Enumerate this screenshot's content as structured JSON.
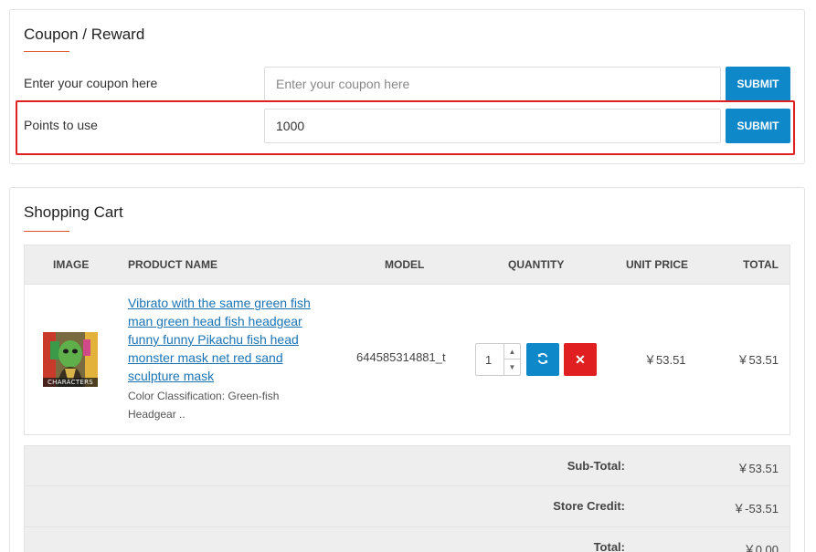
{
  "coupon_panel": {
    "title": "Coupon / Reward",
    "coupon": {
      "label": "Enter your coupon here",
      "placeholder": "Enter your coupon here",
      "value": "",
      "submit_label": "SUBMIT"
    },
    "points": {
      "label": "Points to use",
      "value": "1000",
      "submit_label": "SUBMIT"
    }
  },
  "cart_panel": {
    "title": "Shopping Cart",
    "columns": {
      "image": "IMAGE",
      "name": "PRODUCT NAME",
      "model": "MODEL",
      "quantity": "QUANTITY",
      "unit_price": "UNIT PRICE",
      "total": "TOTAL"
    },
    "items": [
      {
        "name": "Vibrato with the same green fish man green head fish headgear funny funny Pikachu fish head monster mask net red sand sculpture mask",
        "option": "Color Classification: Green-fish Headgear ..",
        "image_caption": "CHARACTERS",
        "model": "644585314881_t",
        "quantity": "1",
        "unit_price": "￥53.51",
        "total": "￥53.51"
      }
    ],
    "totals": [
      {
        "label": "Sub-Total:",
        "value": "￥53.51"
      },
      {
        "label": "Store Credit:",
        "value": "￥-53.51"
      },
      {
        "label": "Total:",
        "value": "￥0.00"
      }
    ]
  },
  "colors": {
    "accent": "#0f88c9",
    "danger": "#e02020",
    "title_underline": "#e2542a",
    "link": "#1a73b5"
  },
  "icons": {
    "update": "refresh-icon",
    "remove": "close-icon",
    "spin_up": "chevron-up-icon",
    "spin_down": "chevron-down-icon"
  }
}
